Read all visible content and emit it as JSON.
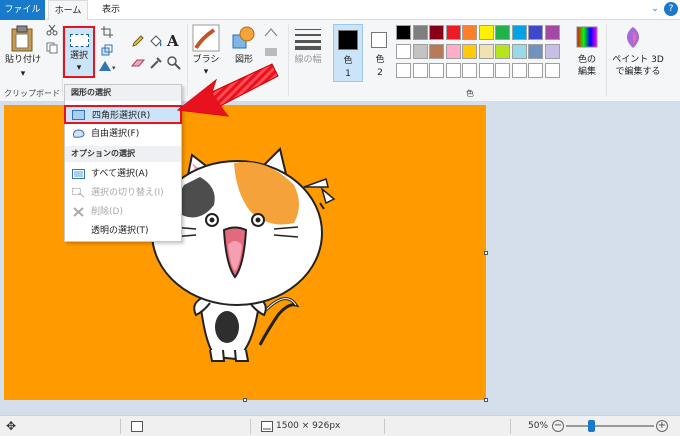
{
  "tabs": {
    "file": "ファイル",
    "home": "ホーム",
    "view": "表示"
  },
  "ribbon": {
    "paste": "貼り付け",
    "clipboard_group": "クリップボード",
    "select": "選択",
    "brush": "ブラシ",
    "shapes": "図形",
    "line_width": "線の幅",
    "color1": "色",
    "color1_num": "1",
    "color2": "色",
    "color2_num": "2",
    "edit_colors_1": "色の",
    "edit_colors_2": "編集",
    "paint3d_1": "ペイント 3D",
    "paint3d_2": "で編集する",
    "colors_group": "色",
    "palette": [
      "#000000",
      "#7f7f7f",
      "#880015",
      "#ed1c24",
      "#ff7f27",
      "#fff200",
      "#22b14c",
      "#00a2e8",
      "#3f48cc",
      "#a349a4",
      "#ffffff",
      "#c3c3c3",
      "#b97a57",
      "#ffaec9",
      "#ffc90e",
      "#efe4b0",
      "#b5e61d",
      "#99d9ea",
      "#7092be",
      "#c8bfe7",
      "#ffffff",
      "#ffffff",
      "#ffffff",
      "#ffffff",
      "#ffffff",
      "#ffffff",
      "#ffffff",
      "#ffffff",
      "#ffffff",
      "#ffffff"
    ]
  },
  "dropdown": {
    "shape_header": "図形の選択",
    "rect": "四角形選択(R)",
    "free": "自由選択(F)",
    "option_header": "オプションの選択",
    "all": "すべて選択(A)",
    "invert": "選択の切り替え(I)",
    "delete": "削除(D)",
    "transparent": "透明の選択(T)"
  },
  "status": {
    "size": "1500 × 926px",
    "zoom": "50%"
  },
  "colors": {
    "accent": "#1979ca",
    "canvas": "#ff9a00",
    "highlight": "#e8121e",
    "selected_bg": "#cce4f7"
  },
  "icons": [
    "paste-icon",
    "scissors-icon",
    "copy-icon",
    "select-rect-icon",
    "crop-icon",
    "resize-icon",
    "rotate-icon",
    "pencil-icon",
    "fill-icon",
    "text-icon",
    "eraser-icon",
    "eyedropper-icon",
    "magnifier-icon",
    "brush-icon",
    "shapes-icon",
    "line-width-icon",
    "color-wheel-icon",
    "paint3d-icon",
    "move-icon",
    "status-select-icon",
    "zoom-minus-icon",
    "zoom-plus-icon",
    "red-arrow",
    "cat-illustration"
  ]
}
